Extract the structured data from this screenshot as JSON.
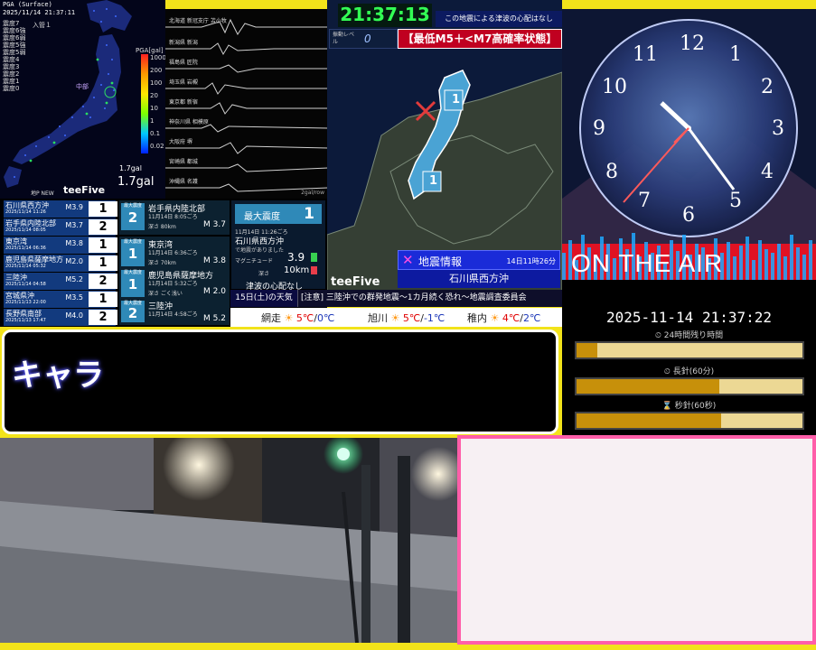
{
  "map_panel": {
    "header_line1": "PGA (Surface)",
    "header_line2": "2025/11/14 21:37:11",
    "legend": [
      "震度7",
      "震度6強",
      "震度6弱",
      "震度5強",
      "震度5弱",
      "震度4",
      "震度3",
      "震度2",
      "震度1",
      "震度0"
    ],
    "label_big": "入管１",
    "label_region": "中部",
    "scale_title": "PGA[gal]",
    "scale_ticks": [
      "1000",
      "200",
      "100",
      "20",
      "10",
      "1",
      "0.1",
      "0.02"
    ],
    "gal_small": "1.7gal",
    "gal_big": "1.7gal",
    "brand": "teeFive",
    "new_label": "地P NEW"
  },
  "waveform_panel": {
    "labels": [
      "北海道 新冠支庁 苫小牧",
      "新潟県 新潟",
      "福島県 匠院",
      "埼玉県 岩槻",
      "東京都 新宿",
      "神奈川県 相模原",
      "大阪府 堺",
      "宮崎県 都城",
      "沖縄県 名護"
    ],
    "footer": "2gal/row"
  },
  "quake_list": {
    "items": [
      {
        "place": "石川県西方沖",
        "time": "2025/11/14 11:26",
        "mag": "M3.9",
        "intensity": "1"
      },
      {
        "place": "岩手県内陸北部",
        "time": "2025/11/14 08:05",
        "mag": "M3.7",
        "intensity": "2"
      },
      {
        "place": "東京湾",
        "time": "2025/11/14 06:36",
        "mag": "M3.8",
        "intensity": "1"
      },
      {
        "place": "鹿児島県薩摩地方",
        "time": "2025/11/14 05:32",
        "mag": "M2.0",
        "intensity": "1"
      },
      {
        "place": "三陸沖",
        "time": "2025/11/14 04:58",
        "mag": "M5.2",
        "intensity": "2"
      },
      {
        "place": "宮城県沖",
        "time": "2025/11/13 22:00",
        "mag": "M3.5",
        "intensity": "1"
      },
      {
        "place": "長野県南部",
        "time": "2025/11/13 17:47",
        "mag": "M4.0",
        "intensity": "2"
      }
    ],
    "detail_label": "最大震度",
    "details": [
      {
        "place": "岩手県内陸北部",
        "date": "11月14日 8:05ごろ",
        "depth": "深さ 80km",
        "mag": "M 3.7",
        "intensity": "2"
      },
      {
        "place": "東京湾",
        "date": "11月14日 6:36ごろ",
        "depth": "深さ 70km",
        "mag": "M 3.8",
        "intensity": "1"
      },
      {
        "place": "鹿児島県薩摩地方",
        "date": "11月14日 5:32ごろ",
        "depth": "深さ ごく浅い",
        "mag": "M 2.0",
        "intensity": "1"
      },
      {
        "place": "三陸沖",
        "date": "11月14日 4:58ごろ",
        "depth": "深さ 10km",
        "mag": "M 5.2",
        "intensity": "2"
      }
    ],
    "latest": {
      "label": "最大震度",
      "value": "1",
      "date": "11月14日 11:26ごろ",
      "place": "石川県西方沖",
      "note": "で地震がありました",
      "mag_label": "マグニチュード",
      "mag": "3.9",
      "depth_label": "深さ",
      "depth": "10km",
      "tsunami": "津波の心配なし"
    }
  },
  "center_map": {
    "time": "21:37:13",
    "tsunami_msg": "この地震による津波の心配はなし",
    "level_label": "振動レベル",
    "level": "0",
    "alert": "【最低M5＋<M7高確率状態】",
    "box_marks": [
      "1",
      "1"
    ],
    "info_title": "地震情報",
    "info_time": "14日11時26分",
    "info_place": "石川県西方沖",
    "brand": "teeFive"
  },
  "ticker": {
    "date_label": "15日(土)の天気",
    "news": "[注意] 三陸沖での群発地震〜1カ月続く恐れ〜地震調査委員会"
  },
  "weather": [
    {
      "city": "網走",
      "hi": "5℃",
      "lo": "0℃"
    },
    {
      "city": "旭川",
      "hi": "5℃",
      "lo": "-1℃"
    },
    {
      "city": "稚内",
      "hi": "4℃",
      "lo": "2℃"
    }
  ],
  "clock_panel": {
    "numbers": [
      "12",
      "1",
      "2",
      "3",
      "4",
      "5",
      "6",
      "7",
      "8",
      "9",
      "10",
      "11"
    ],
    "on_air": "ON THE AIR"
  },
  "status_panel": {
    "datetime": "2025-11-14 21:37:22",
    "bars": [
      {
        "label": "24時間残り時間",
        "progress": 0.09
      },
      {
        "label": "長針(60分)",
        "progress": 0.63
      },
      {
        "label": "秒針(60秒)",
        "progress": 0.64
      }
    ]
  },
  "caption": {
    "text": "キャラ"
  },
  "colors": {
    "frame": "#f2e31a",
    "quake_row": "#123a7e",
    "alert_red": "#e0102a",
    "pink_border": "#ff5ea9"
  }
}
